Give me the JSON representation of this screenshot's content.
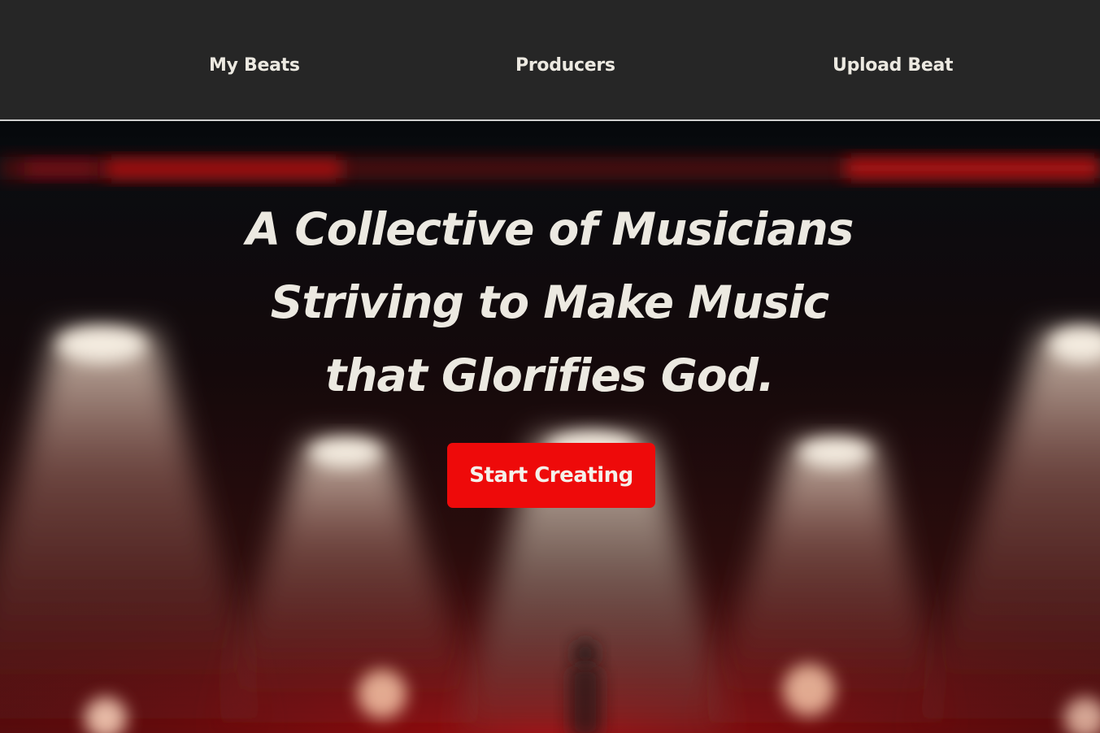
{
  "nav": {
    "items": [
      {
        "label": "My Beats"
      },
      {
        "label": "Producers"
      },
      {
        "label": "Upload Beat"
      }
    ]
  },
  "hero": {
    "title_lines": [
      "A Collective of Musicians",
      "Striving to Make Music",
      "that Glorifies God."
    ],
    "cta_label": "Start Creating"
  },
  "colors": {
    "nav_background": "#262626",
    "text": "#ece9e1",
    "accent": "#ee0a0a"
  }
}
